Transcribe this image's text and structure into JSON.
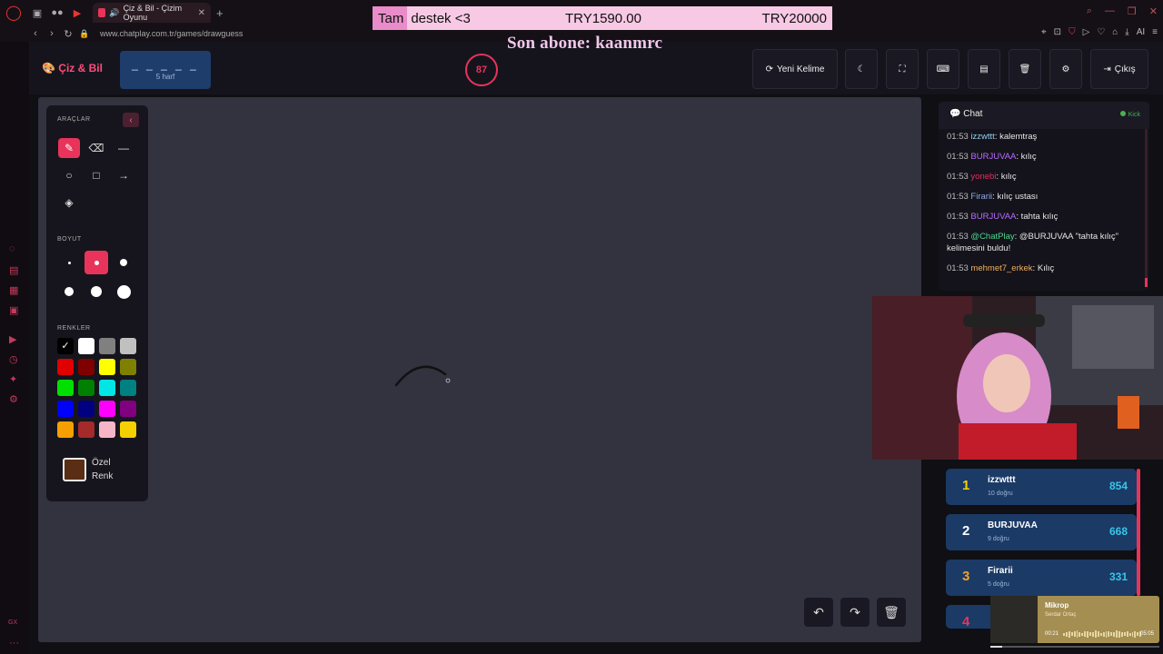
{
  "browser": {
    "tab_title": "Çiz & Bil - Çizim Oyunu",
    "url": "www.chatplay.com.tr/games/drawguess",
    "ai_label": "AI"
  },
  "overlay": {
    "donation_lead": "Tam",
    "donation_text": "destek <3",
    "donation_amount": "TRY1590.00",
    "donation_goal": "TRY20000",
    "last_sub": "Son abone: kaanmrc"
  },
  "header": {
    "logo": "Çiz & Bil",
    "word_blanks": "_ _ _ _ _",
    "word_hint": "5 harf",
    "timer": "87",
    "new_word": "Yeni Kelime",
    "exit": "Çıkış"
  },
  "tools": {
    "tools_label": "ARAÇLAR",
    "size_label": "BOYUT",
    "colors_label": "RENKLER",
    "custom_color_line1": "Özel",
    "custom_color_line2": "Renk",
    "colors": [
      "#000000",
      "#ffffff",
      "#808080",
      "#c0c0c0",
      "#e00000",
      "#800000",
      "#ffff00",
      "#808000",
      "#00e000",
      "#008000",
      "#00e5e5",
      "#008080",
      "#0000ff",
      "#000080",
      "#ff00ff",
      "#800080",
      "#f5a000",
      "#a52a2a",
      "#f7b6c8",
      "#f5d000"
    ],
    "custom_color": "#5a2e14",
    "accent": "#e8345a"
  },
  "chat": {
    "title": "Chat",
    "status": "Kick",
    "messages": [
      {
        "time": "01:53",
        "user": "izzwttt",
        "color": "#8fd0f0",
        "text": ": kalemtraş"
      },
      {
        "time": "01:53",
        "user": "BURJUVAA",
        "color": "#b86bff",
        "text": ": kılıç"
      },
      {
        "time": "01:53",
        "user": "yonebi",
        "color": "#e03060",
        "text": ": kılıç"
      },
      {
        "time": "01:53",
        "user": "Firarii",
        "color": "#8fa8e8",
        "text": ": kılıç ustası"
      },
      {
        "time": "01:53",
        "user": "BURJUVAA",
        "color": "#b86bff",
        "text": ": tahta kılıç"
      },
      {
        "time": "01:53",
        "user": "@ChatPlay",
        "color": "#4fd68f",
        "text": ": @BURJUVAA \"tahta kılıç\" kelimesini buldu!"
      },
      {
        "time": "01:53",
        "user": "mehmet7_erkek",
        "color": "#f0b060",
        "text": ": Kılıç"
      }
    ]
  },
  "leaderboard": [
    {
      "rank": "1",
      "name": "izzwttt",
      "stat": "10 doğru",
      "score": "854",
      "color": "#f5d000"
    },
    {
      "rank": "2",
      "name": "BURJUVAA",
      "stat": "9 doğru",
      "score": "668",
      "color": "#ffffff"
    },
    {
      "rank": "3",
      "name": "Firarii",
      "stat": "5 doğru",
      "score": "331",
      "color": "#f0a030"
    },
    {
      "rank": "4",
      "name": "",
      "stat": "",
      "score": "",
      "color": "#e8345a"
    }
  ],
  "music": {
    "song": "Mikrop",
    "artist": "Serdar Ortaç",
    "elapsed": "00:21",
    "duration": "05:05",
    "progress": 0.07
  },
  "rail_bottom": "GX"
}
